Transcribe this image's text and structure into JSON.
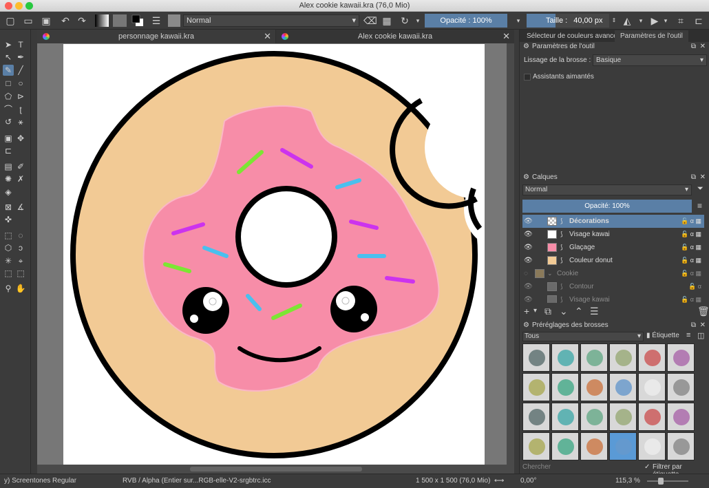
{
  "window": {
    "title": "Alex cookie kawaii.kra (76,0 Mio)"
  },
  "toolbar": {
    "blend_mode": "Normal",
    "opacity_label": "Opacité : 100%",
    "size_label": "Taille :",
    "size_value": "40,00 px"
  },
  "tabs": [
    {
      "label": "personnage kawaii.kra"
    },
    {
      "label": "Alex cookie kawaii.kra"
    }
  ],
  "right": {
    "top_tabs": [
      "Sélecteur de couleurs avancé",
      "Paramètres de l'outil"
    ],
    "tool_options_title": "Paramètres de l'outil",
    "smoothing_label": "Lissage de la brosse :",
    "smoothing_value": "Basique",
    "magnetic_label": "Assistants aimantés",
    "layers_title": "Calques",
    "layers_blend": "Normal",
    "layers_opacity": "Opacité:  100%",
    "layers": [
      {
        "name": "Décorations",
        "selected": true
      },
      {
        "name": "Visage kawai"
      },
      {
        "name": "Glaçage"
      },
      {
        "name": "Couleur donut"
      },
      {
        "name": "Cookie",
        "dim": true
      },
      {
        "name": "Contour",
        "dim": true
      },
      {
        "name": "Visage kawai",
        "dim": true
      }
    ],
    "brushes_title": "Préréglages des brosses",
    "brush_filter": "Tous",
    "brush_tag_label": "Étiquette",
    "search_placeholder": "Chercher",
    "filter_by_tag": "Filtrer par étiquette"
  },
  "status": {
    "brush_name": "y) Screentones Regular",
    "color_profile": "RVB / Alpha (Entier sur...RGB-elle-V2-srgbtrc.icc",
    "doc_size": "1 500 x 1 500 (76,0 Mio)",
    "rotation": "0,00°",
    "zoom": "115,3 %"
  },
  "colors": {
    "accent": "#5a7fa6",
    "donut": "#f2ca95",
    "icing": "#f78da8",
    "bg": "#3b3b3b"
  }
}
